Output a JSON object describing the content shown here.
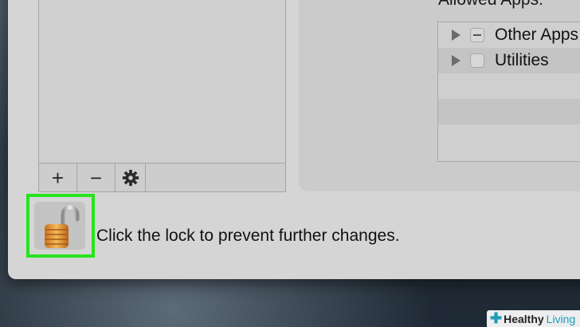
{
  "allowed_apps": {
    "label": "Allowed Apps:",
    "rows": [
      {
        "name": "Other Apps",
        "checkbox": "mixed"
      },
      {
        "name": "Utilities",
        "checkbox": "unchecked"
      }
    ]
  },
  "toolbar": {
    "add_label": "+",
    "remove_label": "−",
    "gear_icon": "gear-icon"
  },
  "lock": {
    "state": "unlocked",
    "message": "Click the lock to prevent further changes."
  },
  "watermark": {
    "part1": "Healthy",
    "part2": "Living"
  },
  "colors": {
    "highlight": "#27e41d",
    "watermark_accent": "#1f9bb4"
  }
}
